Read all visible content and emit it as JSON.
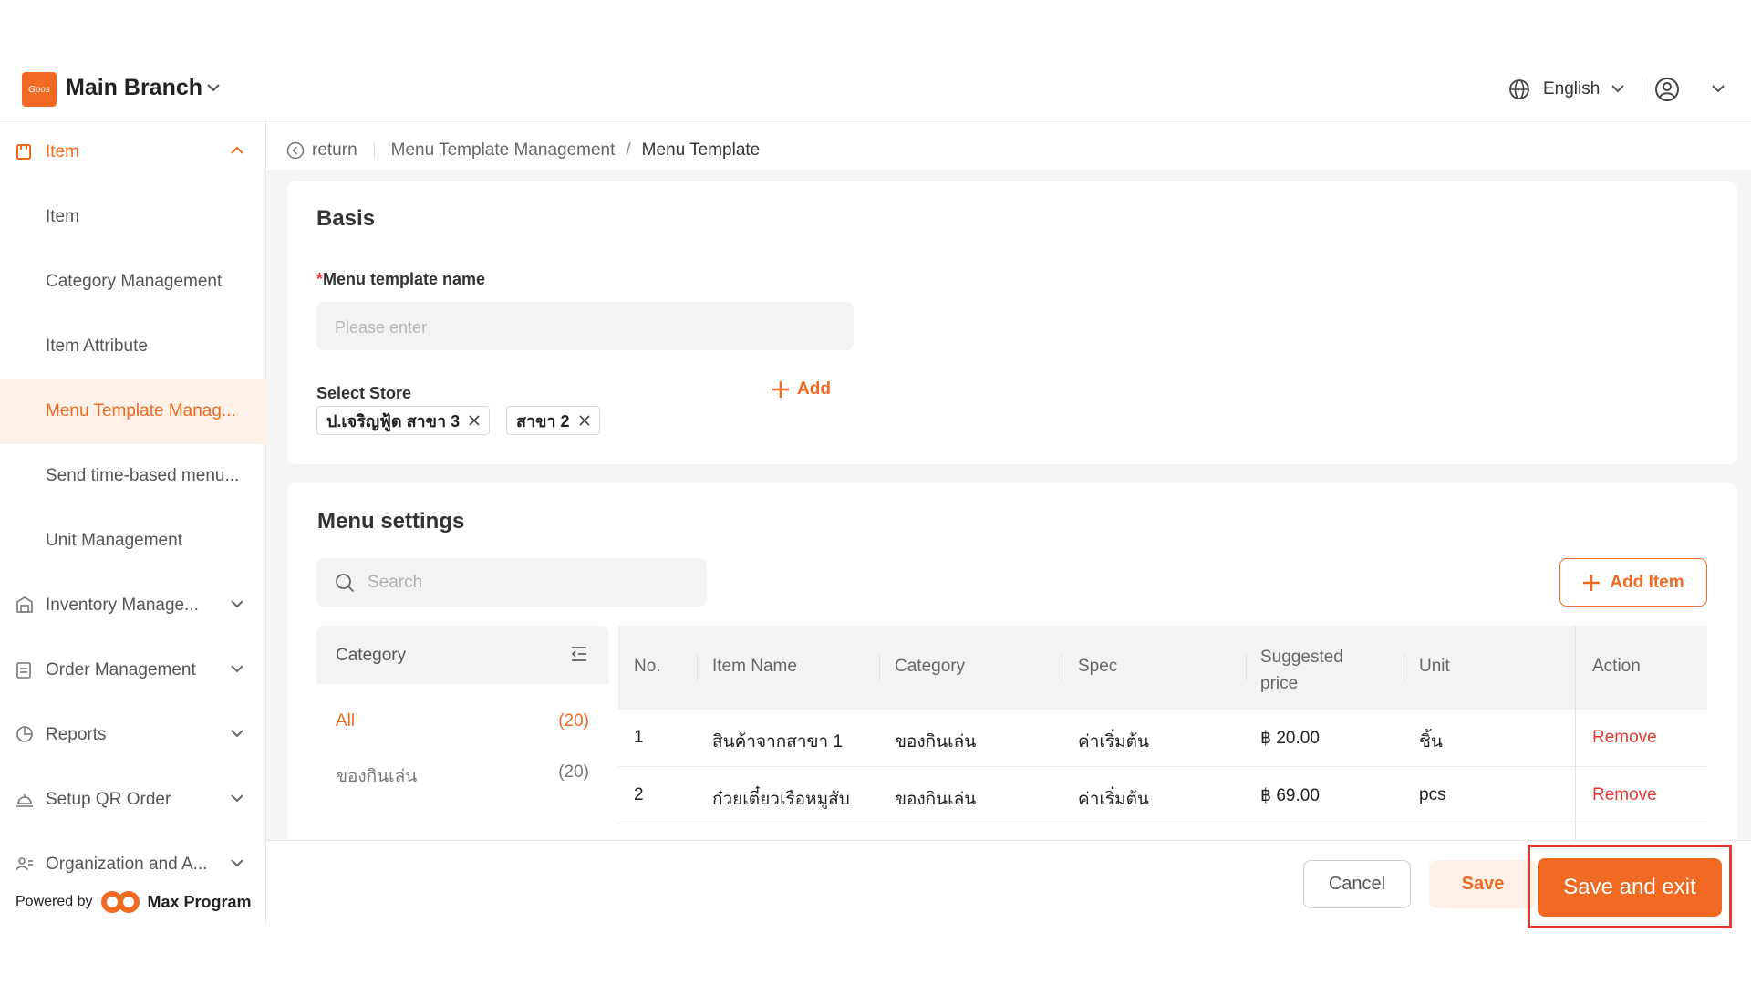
{
  "header": {
    "logo_text": "Gpos",
    "branch": "Main Branch",
    "language": "English"
  },
  "sidebar": {
    "items": [
      {
        "label": "Item",
        "icon": "item-icon"
      },
      {
        "label": "Item"
      },
      {
        "label": "Category Management"
      },
      {
        "label": "Item Attribute"
      },
      {
        "label": "Menu Template Manag..."
      },
      {
        "label": "Send time-based menu..."
      },
      {
        "label": "Unit Management"
      },
      {
        "label": "Inventory Manage...",
        "icon": "warehouse-icon"
      },
      {
        "label": "Order Management",
        "icon": "clipboard-icon"
      },
      {
        "label": "Reports",
        "icon": "pie-chart-icon"
      },
      {
        "label": "Setup QR Order",
        "icon": "cloche-icon"
      },
      {
        "label": "Organization and A...",
        "icon": "people-icon"
      }
    ],
    "powered_by": "Powered by",
    "brand": "Max Program"
  },
  "breadcrumb": {
    "return": "return",
    "parent": "Menu Template Management",
    "separator": "/",
    "current": "Menu Template"
  },
  "basis": {
    "title": "Basis",
    "required_mark": "*",
    "name_label": "Menu template name",
    "name_placeholder": "Please enter",
    "store_label": "Select Store",
    "add_label": "Add",
    "stores": [
      "ป.เจริญฟู้ด สาขา 3",
      "สาขา 2"
    ]
  },
  "menu_settings": {
    "title": "Menu settings",
    "search_placeholder": "Search",
    "add_item_label": "Add Item",
    "category_header": "Category",
    "categories": [
      {
        "name": "All",
        "count": "(20)"
      },
      {
        "name": "ของกินเล่น",
        "count": "(20)"
      }
    ],
    "columns": [
      "No.",
      "Item Name",
      "Category",
      "Spec",
      "Suggested price",
      "Unit",
      "Action"
    ],
    "rows": [
      {
        "no": "1",
        "name": "สินค้าจากสาขา 1",
        "category": "ของกินเล่น",
        "spec": "ค่าเริ่มต้น",
        "price": "฿ 20.00",
        "unit": "ชิ้น",
        "action": "Remove"
      },
      {
        "no": "2",
        "name": "ก๋วยเตี๋ยวเรือหมูสับ",
        "category": "ของกินเล่น",
        "spec": "ค่าเริ่มต้น",
        "price": "฿ 69.00",
        "unit": "pcs",
        "action": "Remove"
      }
    ]
  },
  "footer": {
    "cancel": "Cancel",
    "save": "Save",
    "save_exit": "Save and exit"
  },
  "colors": {
    "accent": "#f26a21",
    "danger": "#e53935"
  }
}
